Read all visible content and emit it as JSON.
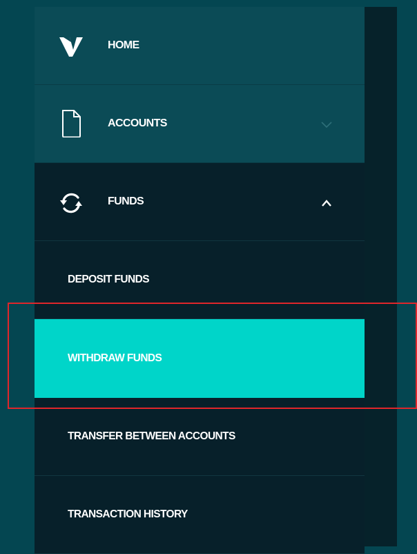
{
  "nav": {
    "home": {
      "label": "HOME",
      "icon": "brand-v-logo-icon"
    },
    "accounts": {
      "label": "ACCOUNTS",
      "icon": "document-icon",
      "expanded": false
    },
    "funds": {
      "label": "FUNDS",
      "icon": "refresh-icon",
      "expanded": true
    },
    "funds_items": [
      {
        "label": "DEPOSIT FUNDS",
        "active": false
      },
      {
        "label": "WITHDRAW FUNDS",
        "active": true
      },
      {
        "label": "TRANSFER BETWEEN ACCOUNTS",
        "active": false
      },
      {
        "label": "TRANSACTION HISTORY",
        "active": false
      }
    ]
  },
  "colors": {
    "page_background": "#044651",
    "sidebar_background": "#07202a",
    "top_item_background": "#0b4b56",
    "active_item": "#00d5c9",
    "highlight_border": "#e0262b",
    "text": "#ffffff"
  }
}
